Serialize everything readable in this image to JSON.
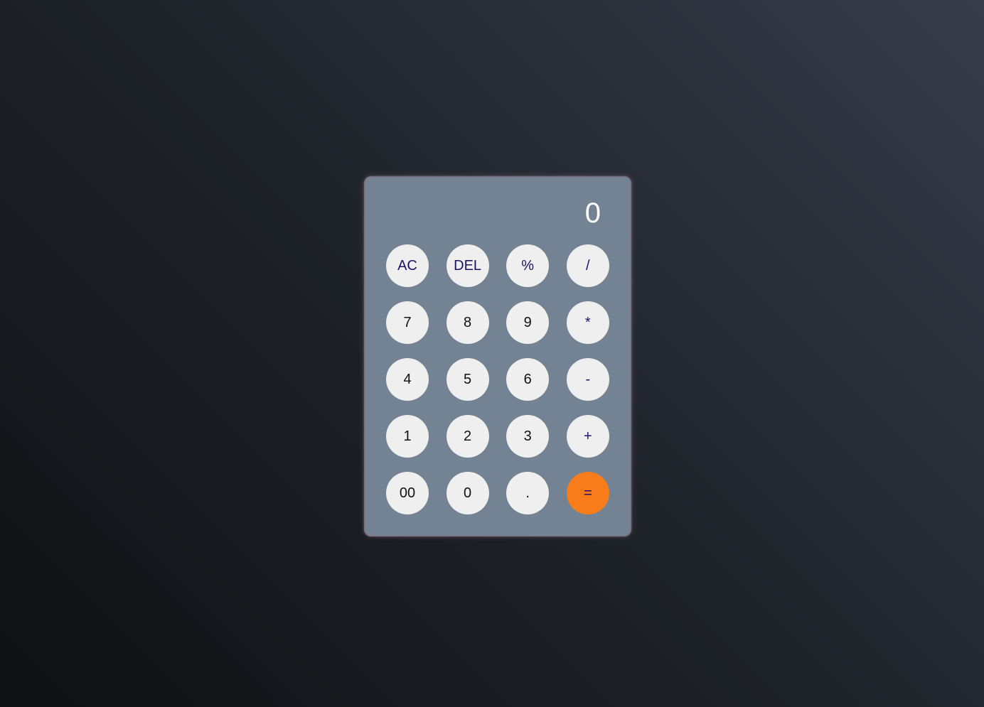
{
  "calculator": {
    "display_value": "0",
    "keys": [
      {
        "label": "AC",
        "type": "op",
        "name": "all-clear-button"
      },
      {
        "label": "DEL",
        "type": "op",
        "name": "delete-button"
      },
      {
        "label": "%",
        "type": "op",
        "name": "percent-button"
      },
      {
        "label": "/",
        "type": "op",
        "name": "divide-button"
      },
      {
        "label": "7",
        "type": "num",
        "name": "digit-7-button"
      },
      {
        "label": "8",
        "type": "num",
        "name": "digit-8-button"
      },
      {
        "label": "9",
        "type": "num",
        "name": "digit-9-button"
      },
      {
        "label": "*",
        "type": "op",
        "name": "multiply-button"
      },
      {
        "label": "4",
        "type": "num",
        "name": "digit-4-button"
      },
      {
        "label": "5",
        "type": "num",
        "name": "digit-5-button"
      },
      {
        "label": "6",
        "type": "num",
        "name": "digit-6-button"
      },
      {
        "label": "-",
        "type": "op",
        "name": "subtract-button"
      },
      {
        "label": "1",
        "type": "num",
        "name": "digit-1-button"
      },
      {
        "label": "2",
        "type": "num",
        "name": "digit-2-button"
      },
      {
        "label": "3",
        "type": "num",
        "name": "digit-3-button"
      },
      {
        "label": "+",
        "type": "op",
        "name": "add-button"
      },
      {
        "label": "00",
        "type": "num",
        "name": "double-zero-button"
      },
      {
        "label": "0",
        "type": "num",
        "name": "digit-0-button"
      },
      {
        "label": ".",
        "type": "num",
        "name": "decimal-point-button"
      },
      {
        "label": "=",
        "type": "equals",
        "name": "equals-button"
      }
    ]
  },
  "colors": {
    "panel": "#738393",
    "key": "#efefef",
    "operator_text": "#1b1466",
    "equals": "#f87d1a"
  }
}
